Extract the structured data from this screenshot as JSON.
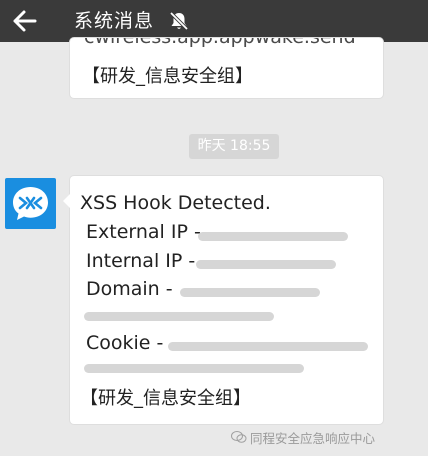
{
  "header": {
    "title": "系统消息",
    "icons": {
      "back": "back-arrow-icon",
      "mute": "mute-bell-icon"
    }
  },
  "messages": [
    {
      "partial_line": "cwireless.app.appwake.send",
      "tag": "【研发_信息安全组】"
    },
    {
      "heading": "XSS Hook Detected.",
      "fields": [
        {
          "label": "External IP - "
        },
        {
          "label": "Internal IP - "
        },
        {
          "label": "Domain - "
        },
        {
          "label": "Cookie - "
        }
      ],
      "tag": "【研发_信息安全组】"
    }
  ],
  "timestamp": "昨天 18:55",
  "watermark": "同程安全应急响应中心",
  "colors": {
    "titlebar": "#3a3a3a",
    "avatar": "#1a8ee0",
    "background": "#e9e9e9"
  }
}
